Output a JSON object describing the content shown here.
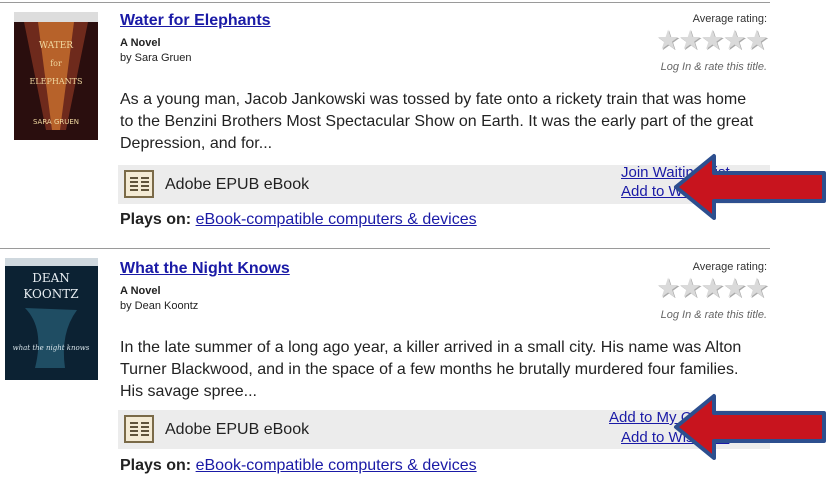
{
  "books": [
    {
      "title": "Water for Elephants",
      "subtitle": "A Novel",
      "author": "by Sara Gruen",
      "rating_label": "Average rating:",
      "stars": "★★★★★",
      "rate_link": "Log In & rate this title.",
      "description": "As a young man, Jacob Jankowski was tossed by fate onto a rickety train that was home to the Benzini Brothers Most Spectacular Show on Earth. It was the early part of the great Depression, and for...",
      "format": "Adobe EPUB eBook",
      "action_1": "Join Waiting List",
      "action_2": "Add to Wish List",
      "plays_label": "Plays on:",
      "plays_link": "eBook-compatible computers & devices"
    },
    {
      "title": "What the Night Knows",
      "subtitle": "A Novel",
      "author": "by Dean Koontz",
      "rating_label": "Average rating:",
      "stars": "★★★★★",
      "rate_link": "Log In & rate this title.",
      "description": "In the late summer of a long ago year, a killer arrived in a small city. His name was Alton Turner Blackwood, and in the space of a few months he brutally murdered four families. His savage spree...",
      "format": "Adobe EPUB eBook",
      "action_1": "Add to My Cart",
      "action_2": "Add to Wish List",
      "plays_label": "Plays on:",
      "plays_link": "eBook-compatible computers & devices"
    }
  ],
  "covers": [
    {
      "author_text": "SARA GRUEN",
      "title_text": "WATER for ELEPHANTS"
    },
    {
      "author_text": "DEAN KOONTZ",
      "title_text": "what the night knows"
    }
  ],
  "colors": {
    "link": "#1a1aa6",
    "arrow_fill": "#c8141e",
    "arrow_outline": "#2d4f8f",
    "format_bar": "#ececec"
  }
}
